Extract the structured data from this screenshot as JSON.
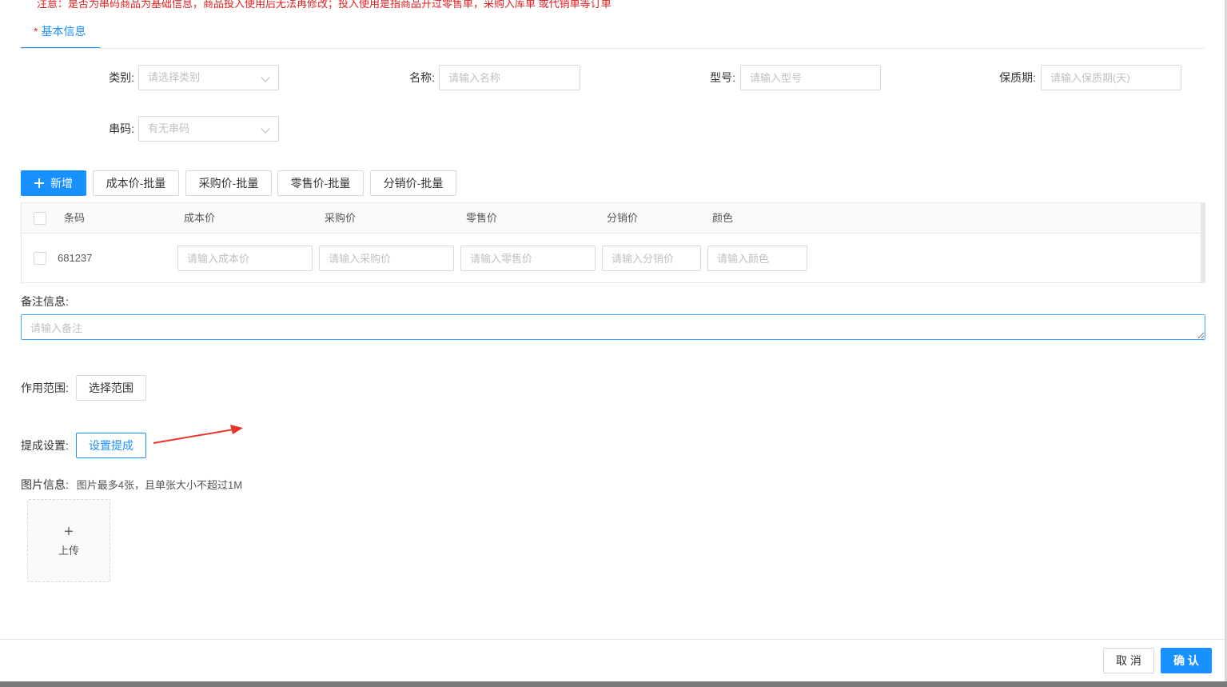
{
  "notice": "注意：是否为串码商品为基础信息，商品投入使用后无法再修改；投入使用是指商品开过零售单，采购入库单 或代销单等订单",
  "tab": {
    "required_mark": "*",
    "label": "基本信息"
  },
  "form": {
    "category": {
      "label": "类别:",
      "placeholder": "请选择类别"
    },
    "name": {
      "label": "名称:",
      "placeholder": "请输入名称"
    },
    "model": {
      "label": "型号:",
      "placeholder": "请输入型号"
    },
    "shelf_life": {
      "label": "保质期:",
      "placeholder": "请输入保质期(天)"
    },
    "serial": {
      "label": "串码:",
      "placeholder": "有无串码"
    }
  },
  "toolbar": {
    "add_label": "新增",
    "cost_batch": "成本价-批量",
    "purchase_batch": "采购价-批量",
    "retail_batch": "零售价-批量",
    "distribution_batch": "分销价-批量"
  },
  "table": {
    "columns": [
      "条码",
      "成本价",
      "采购价",
      "零售价",
      "分销价",
      "颜色"
    ],
    "rows": [
      {
        "barcode": "681237",
        "placeholders": {
          "cost": "请输入成本价",
          "purchase": "请输入采购价",
          "retail": "请输入零售价",
          "distribution": "请输入分销价",
          "color": "请输入颜色"
        }
      }
    ]
  },
  "remark": {
    "label": "备注信息:",
    "placeholder": "请输入备注"
  },
  "scope": {
    "label": "作用范围:",
    "button": "选择范围"
  },
  "commission": {
    "label": "提成设置:",
    "button": "设置提成"
  },
  "images": {
    "label": "图片信息:",
    "hint": "图片最多4张，且单张大小不超过1M",
    "upload_plus": "+",
    "upload_label": "上传"
  },
  "footer": {
    "cancel": "取 消",
    "confirm": "确 认"
  },
  "colors": {
    "primary": "#1890ff",
    "danger": "#e02020",
    "annotation_arrow": "#e8352a"
  },
  "icons": [
    "plus-icon",
    "chevron-down-icon",
    "annotation-arrow-icon"
  ]
}
